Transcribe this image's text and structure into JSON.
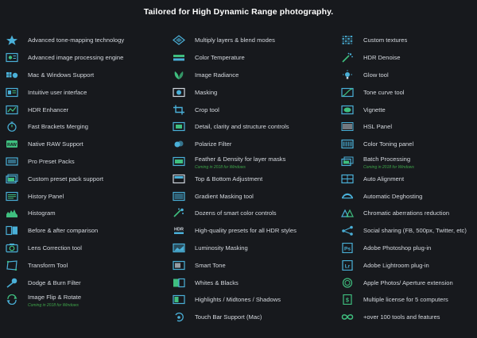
{
  "title": "Tailored for High Dynamic Range photography.",
  "accent_color": "#4ab0d8",
  "note_color": "#3fa54a",
  "columns": [
    {
      "items": [
        {
          "label": "Advanced tone-mapping technology",
          "icon": "star-icon"
        },
        {
          "label": "Advanced image processing engine",
          "icon": "gear-screen-icon"
        },
        {
          "label": "Mac & Windows Support",
          "icon": "os-logos-icon"
        },
        {
          "label": "Intuitive user interface",
          "icon": "window-icon"
        },
        {
          "label": "HDR Enhancer",
          "icon": "enhancer-icon"
        },
        {
          "label": "Fast Brackets Merging",
          "icon": "stopwatch-icon"
        },
        {
          "label": "Native RAW Support",
          "icon": "raw-icon"
        },
        {
          "label": "Pro Preset Packs",
          "icon": "preset-icon"
        },
        {
          "label": "Custom preset pack support",
          "icon": "preset-pack-icon"
        },
        {
          "label": "History Panel",
          "icon": "history-icon"
        },
        {
          "label": "Histogram",
          "icon": "histogram-icon"
        },
        {
          "label": "Before & after comparison",
          "icon": "compare-icon"
        },
        {
          "label": "Lens Correction tool",
          "icon": "lens-icon"
        },
        {
          "label": "Transform Tool",
          "icon": "transform-icon"
        },
        {
          "label": "Dodge & Burn Filter",
          "icon": "dodge-burn-icon"
        },
        {
          "label": "Image Flip & Rotate",
          "icon": "rotate-icon",
          "note": "Coming in 2018 for Windows"
        }
      ]
    },
    {
      "items": [
        {
          "label": "Multiply layers & blend modes",
          "icon": "layers-icon"
        },
        {
          "label": "Color Temperature",
          "icon": "temperature-icon"
        },
        {
          "label": "Image Radiance",
          "icon": "radiance-icon"
        },
        {
          "label": "Masking",
          "icon": "masking-icon"
        },
        {
          "label": "Crop tool",
          "icon": "crop-icon"
        },
        {
          "label": "Detail, clarity and structure controls",
          "icon": "detail-icon"
        },
        {
          "label": "Polarize Filter",
          "icon": "polarize-icon"
        },
        {
          "label": "Feather & Density for layer masks",
          "icon": "feather-icon",
          "note": "Coming in 2018 for Windows"
        },
        {
          "label": "Top & Bottom Adjustment",
          "icon": "top-bottom-icon"
        },
        {
          "label": "Gradient Masking tool",
          "icon": "gradient-mask-icon"
        },
        {
          "label": "Dozens of smart color controls",
          "icon": "color-controls-icon"
        },
        {
          "label": "High-quality presets for all HDR styles",
          "icon": "hdr-badge-icon"
        },
        {
          "label": "Luminosity Masking",
          "icon": "luminosity-icon"
        },
        {
          "label": "Smart Tone",
          "icon": "smart-tone-icon"
        },
        {
          "label": "Whites & Blacks",
          "icon": "whites-blacks-icon"
        },
        {
          "label": "Highlights / Midtones / Shadows",
          "icon": "tones-icon"
        },
        {
          "label": "Touch Bar Support (Mac)",
          "icon": "touch-icon"
        }
      ]
    },
    {
      "items": [
        {
          "label": "Custom textures",
          "icon": "texture-icon"
        },
        {
          "label": "HDR Denoise",
          "icon": "denoise-icon"
        },
        {
          "label": "Glow tool",
          "icon": "glow-icon"
        },
        {
          "label": "Tone curve tool",
          "icon": "curve-icon"
        },
        {
          "label": "Vignette",
          "icon": "vignette-icon"
        },
        {
          "label": "HSL Panel",
          "icon": "hsl-icon"
        },
        {
          "label": "Color Toning panel",
          "icon": "toning-icon"
        },
        {
          "label": "Batch Processing",
          "icon": "batch-icon",
          "note": "Coming in 2018 for Windows"
        },
        {
          "label": "Auto Alignment",
          "icon": "align-icon"
        },
        {
          "label": "Automatic Deghosting",
          "icon": "deghost-icon"
        },
        {
          "label": "Chromatic aberrations reduction",
          "icon": "chromatic-icon"
        },
        {
          "label": "Social sharing (FB, 500px, Twitter, etc)",
          "icon": "share-icon"
        },
        {
          "label": "Adobe Photoshop plug-in",
          "icon": "ps-icon",
          "badge": "Ps"
        },
        {
          "label": "Adobe Lightroom plug-in",
          "icon": "lr-icon",
          "badge": "Lr"
        },
        {
          "label": "Apple Photos/ Aperture extension",
          "icon": "aperture-icon"
        },
        {
          "label": "Multiple license for 5 computers",
          "icon": "license-icon"
        },
        {
          "label": "+over 100 tools and features",
          "icon": "infinity-icon"
        }
      ]
    }
  ]
}
